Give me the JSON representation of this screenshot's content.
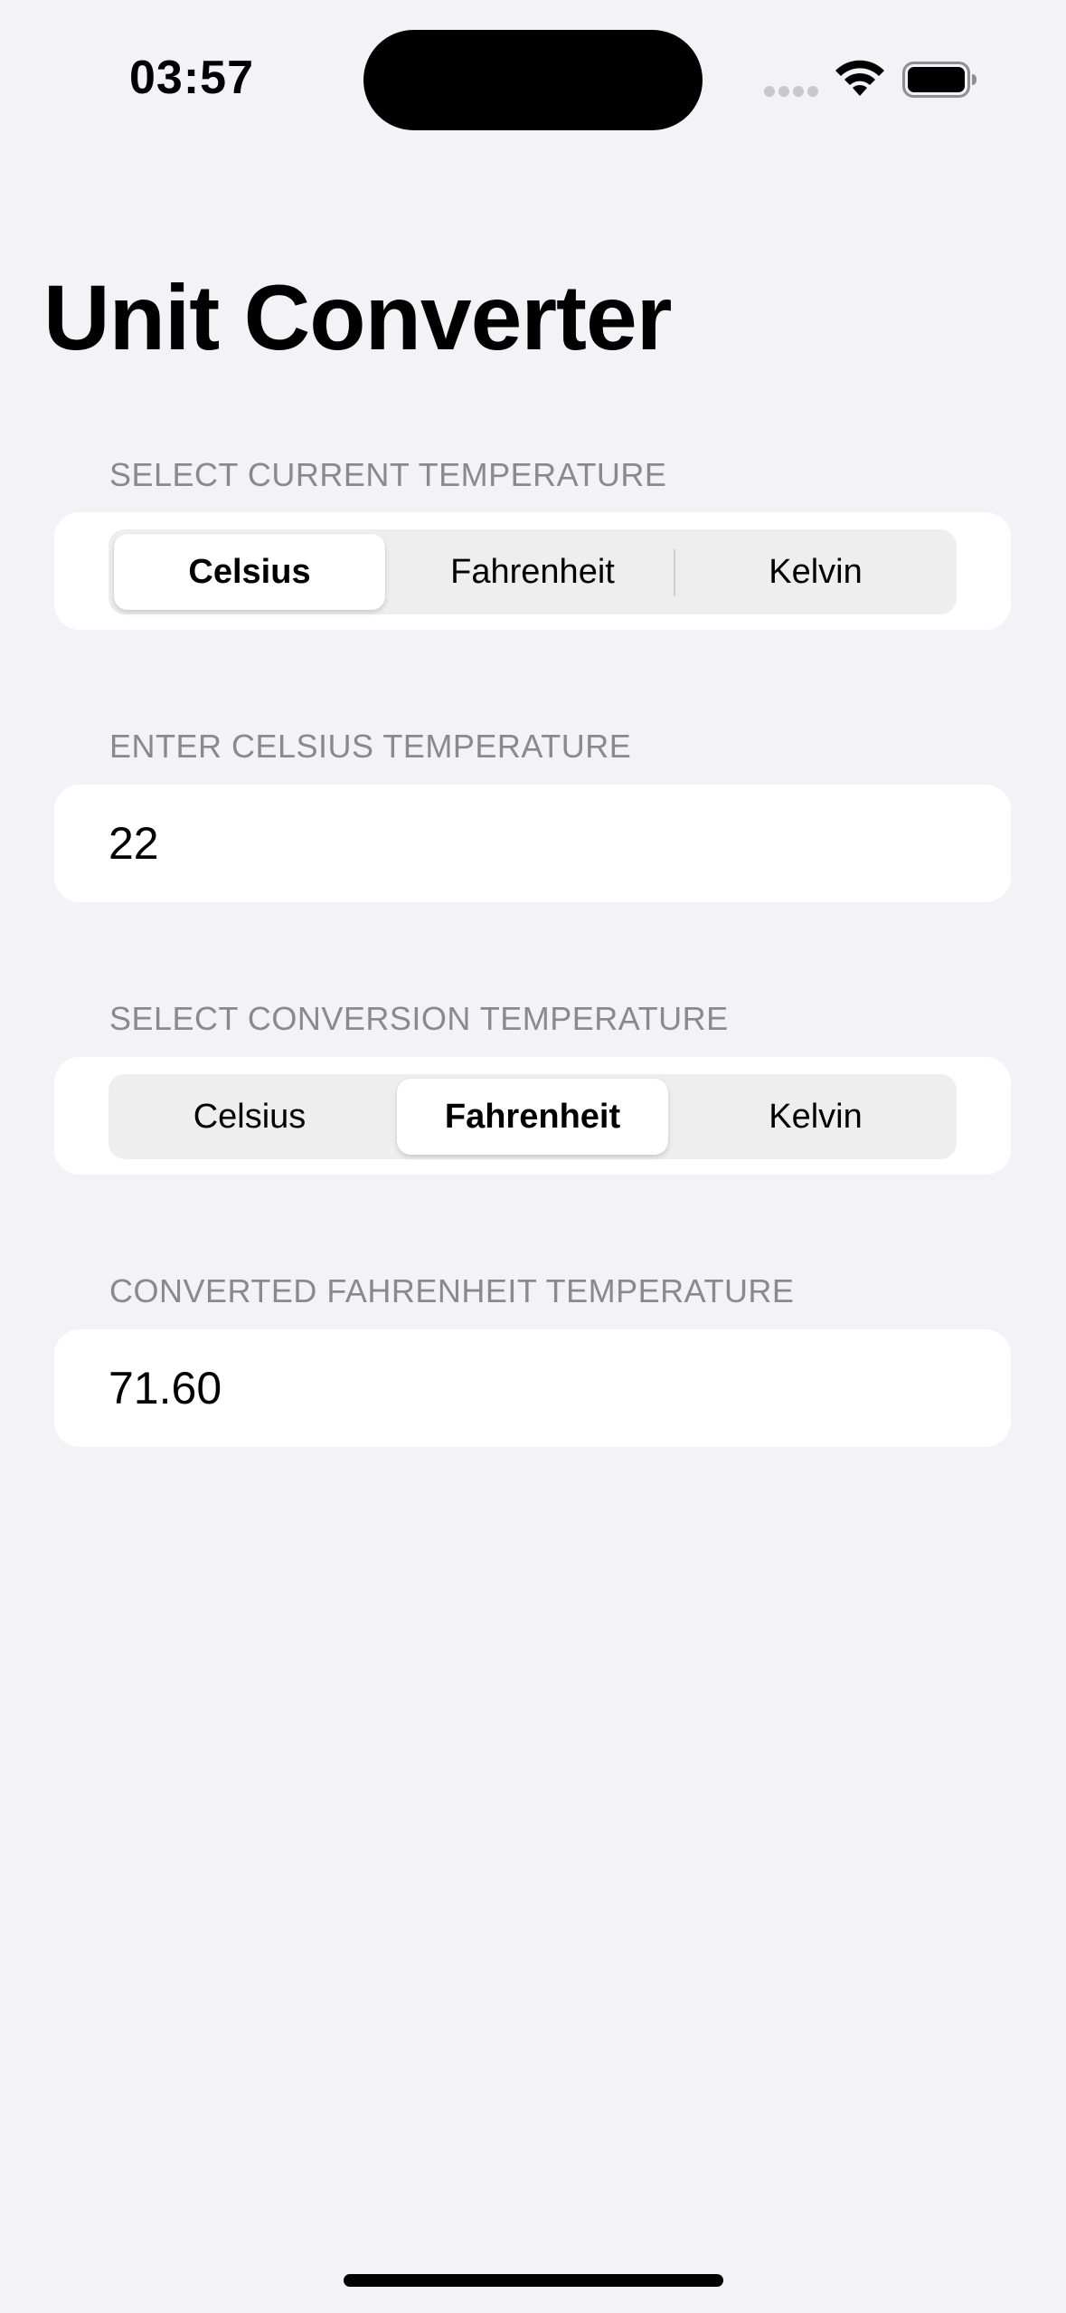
{
  "status_bar": {
    "time": "03:57",
    "icons": [
      "cellular-signal-icon",
      "wifi-icon",
      "battery-icon"
    ]
  },
  "title": "Unit Converter",
  "current_section": {
    "header": "SELECT CURRENT TEMPERATURE",
    "options": [
      "Celsius",
      "Fahrenheit",
      "Kelvin"
    ],
    "selected": "Celsius"
  },
  "input_section": {
    "header": "ENTER CELSIUS TEMPERATURE",
    "value": "22"
  },
  "conversion_section": {
    "header": "SELECT CONVERSION TEMPERATURE",
    "options": [
      "Celsius",
      "Fahrenheit",
      "Kelvin"
    ],
    "selected": "Fahrenheit"
  },
  "result_section": {
    "header": "CONVERTED FAHRENHEIT TEMPERATURE",
    "value": "71.60"
  },
  "colors": {
    "background": "#f2f2f7",
    "card": "#ffffff",
    "segment_track": "#eeeeef",
    "secondary_text": "#8a8a8e"
  }
}
